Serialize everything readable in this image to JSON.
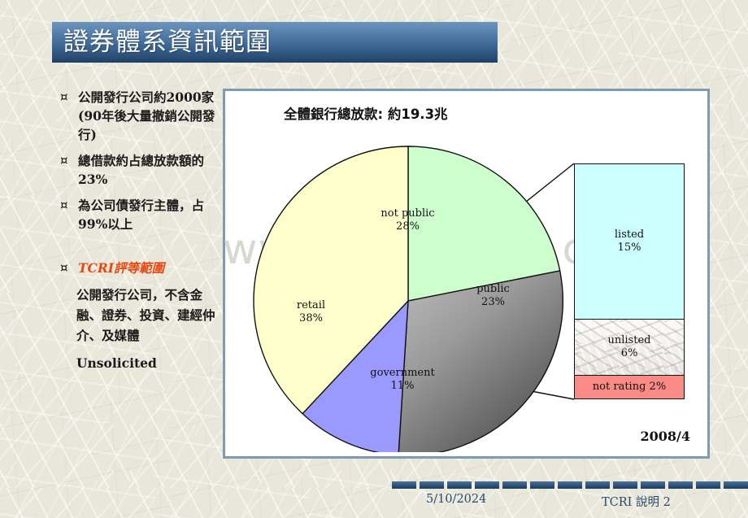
{
  "slide": {
    "title": "證券體系資訊範圍",
    "bullet_glyph": "¤"
  },
  "bullets": [
    {
      "text": "公開發行公司約2000家(90年後大量撤銷公開發行)",
      "accent": false
    },
    {
      "text": "總借款約占總放款額的 23%",
      "accent": false
    },
    {
      "text": "為公司債發行主體，占99%以上",
      "accent": false
    },
    {
      "text": "TCRI評等範圍",
      "accent": true
    }
  ],
  "sub_paragraphs": [
    "公開發行公司，不含金融、證券、投資、建經仲介、及媒體",
    "Unsolicited"
  ],
  "chart": {
    "title": "全體銀行總放款: 約19.3兆",
    "date_label": "2008/4",
    "watermark": "www.zixin.com.cn"
  },
  "footer": {
    "date": "5/10/2024",
    "note": "TCRI 說明 2"
  },
  "colors": {
    "title_bar_top": "#6d94bd",
    "title_bar_bottom": "#20405f",
    "accent_text": "#e8480f",
    "background": "#e9e7d9",
    "frame_border": "#7e9ab5",
    "not_public": "#ccffcc",
    "public_light": "#b3b3b3",
    "public_dark": "#595959",
    "government": "#9999ff",
    "retail": "#ffffcc",
    "listed": "#ccffff",
    "unlisted": "#f2f1ef",
    "not_rating": "#f98a84"
  },
  "chart_data": {
    "type": "pie",
    "title": "全體銀行總放款: 約19.3兆",
    "xlabel": "",
    "ylabel": "",
    "legend": "none",
    "grid": false,
    "categories": [
      "not public",
      "public",
      "government",
      "retail"
    ],
    "values": [
      28,
      23,
      11,
      38
    ],
    "unit": "%",
    "labels": [
      "not public\n28%",
      "public\n23%",
      "government\n11%",
      "retail\n38%"
    ],
    "slices": [
      {
        "name": "not public",
        "value": 28,
        "display": "28%",
        "color": "#ccffcc",
        "start_deg": 0,
        "end_deg": 100.8
      },
      {
        "name": "public",
        "value": 23,
        "display": "23%",
        "color": "#808080",
        "start_deg": 100.8,
        "end_deg": 183.6
      },
      {
        "name": "government",
        "value": 11,
        "display": "11%",
        "color": "#9999ff",
        "start_deg": 183.6,
        "end_deg": 223.2
      },
      {
        "name": "retail",
        "value": 38,
        "display": "38%",
        "color": "#ffffcc",
        "start_deg": 223.2,
        "end_deg": 360
      }
    ],
    "callout": {
      "type": "stacked_bar",
      "source_slice": "public",
      "categories": [
        "listed",
        "unlisted",
        "not rating"
      ],
      "values": [
        15,
        6,
        2
      ],
      "unit": "%",
      "segments": [
        {
          "name": "listed",
          "value": 15,
          "label": "listed",
          "display": "15%",
          "color": "#ccffff"
        },
        {
          "name": "unlisted",
          "value": 6,
          "label": "unlisted",
          "display": "6%",
          "color": "#f2f1ef"
        },
        {
          "name": "not rating",
          "value": 2,
          "label": "not rating 2%",
          "display": "2%",
          "color": "#f98a84"
        }
      ]
    },
    "annotation": "2008/4"
  }
}
